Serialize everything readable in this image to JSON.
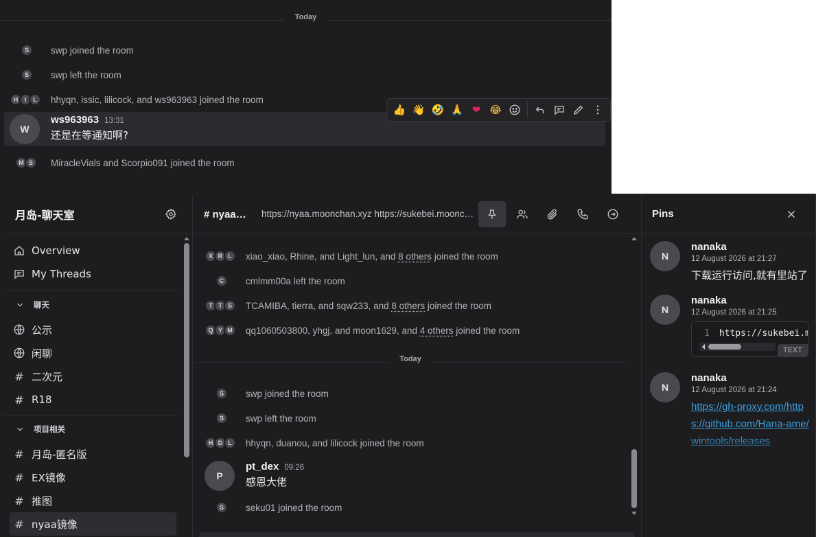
{
  "top_window": {
    "date_separator": "Today",
    "events": [
      {
        "avatars": [
          "S"
        ],
        "text": "swp joined the room"
      },
      {
        "avatars": [
          "S"
        ],
        "text": "swp left the room"
      },
      {
        "avatars": [
          "H",
          "I",
          "L"
        ],
        "text": "hhyqn, issic, lilicock, and ws963963 joined the room"
      }
    ],
    "message": {
      "avatar": "W",
      "sender": "ws963963",
      "time": "13:31",
      "body": "还是在等通知啊?"
    },
    "last_event": {
      "avatars": [
        "M",
        "S"
      ],
      "text": "MiracleVials and Scorpio091 joined the room"
    },
    "reactions": [
      "👍",
      "👋",
      "🤣",
      "🙏",
      "❤",
      "😂"
    ]
  },
  "sidebar": {
    "room_name": "月岛-聊天室",
    "nav": [
      {
        "label": "Overview"
      },
      {
        "label": "My Threads"
      }
    ],
    "sections": [
      {
        "title": "聊天",
        "items": [
          {
            "label": "公示",
            "icon": "globe-icon"
          },
          {
            "label": "闲聊",
            "icon": "globe-icon"
          },
          {
            "label": "二次元",
            "icon": "hash-icon"
          },
          {
            "label": "R18",
            "icon": "hash-icon"
          }
        ]
      },
      {
        "title": "项目相关",
        "items": [
          {
            "label": "月岛-匿名版",
            "icon": "hash-icon"
          },
          {
            "label": "EX镜像",
            "icon": "hash-icon"
          },
          {
            "label": "推图",
            "icon": "hash-icon"
          },
          {
            "label": "nyaa镜像",
            "icon": "hash-icon",
            "active": true
          }
        ]
      }
    ]
  },
  "chat": {
    "room_title": "# nyaa镜像",
    "topic": "https://nyaa.moonchan.xyz https://sukebei.moonchan.xyz",
    "events_before": [
      {
        "avatars": [
          "X",
          "R",
          "L"
        ],
        "prefix": "xiao_xiao, Rhine, and Light_lun, and ",
        "link": "8 others",
        "suffix": " joined the room"
      },
      {
        "avatars": [
          "C"
        ],
        "prefix": "cmlmm00a left the room",
        "link": "",
        "suffix": ""
      },
      {
        "avatars": [
          "T",
          "T",
          "S"
        ],
        "prefix": "TCAMIBA, tierra, and sqw233, and ",
        "link": "8 others",
        "suffix": " joined the room"
      },
      {
        "avatars": [
          "Q",
          "Y",
          "M"
        ],
        "prefix": "qq1060503800, yhgj, and moon1629, and ",
        "link": "4 others",
        "suffix": " joined the room"
      }
    ],
    "date_separator": "Today",
    "events_after": [
      {
        "avatars": [
          "S"
        ],
        "text": "swp joined the room"
      },
      {
        "avatars": [
          "S"
        ],
        "text": "swp left the room"
      },
      {
        "avatars": [
          "H",
          "D",
          "L"
        ],
        "text": "hhyqn, duanou, and lilicock joined the room"
      }
    ],
    "message": {
      "avatar": "P",
      "sender": "pt_dex",
      "time": "09:26",
      "body": "感恩大佬"
    },
    "last_event": {
      "avatars": [
        "S"
      ],
      "text": "seku01 joined the room"
    }
  },
  "pins": {
    "title": "Pins",
    "items": [
      {
        "avatar": "N",
        "sender": "nanaka",
        "time": "12 August 2026 at 21:27",
        "body": "下载运行访问,就有里站了"
      },
      {
        "avatar": "N",
        "sender": "nanaka",
        "time": "12 August 2026 at 21:25",
        "code_line_no": "1",
        "code": "https://sukebei.moonchan.xyz",
        "code_lang": "TEXT"
      },
      {
        "avatar": "N",
        "sender": "nanaka",
        "time": "12 August 2026 at 21:24",
        "link": "https://gh-proxy.com/https://github.com/Hana-ame/wintools/releases"
      }
    ]
  }
}
